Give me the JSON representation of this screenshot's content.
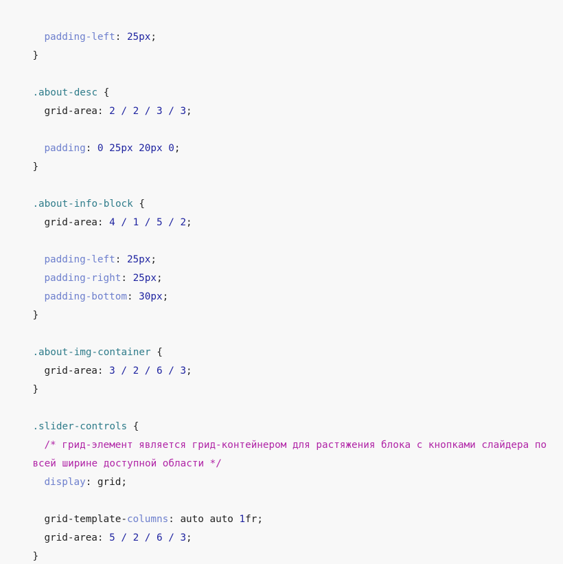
{
  "colors": {
    "background": "#f8f8f8",
    "selector": "#2f7c8a",
    "property_highlight": "#6d7fcd",
    "number": "#1e23a0",
    "comment": "#b024a6",
    "text": "#1f1f1f"
  },
  "code": {
    "l1": {
      "prop": "padding-left",
      "colon": ":",
      "value": "25px",
      "semi": ";"
    },
    "l2": {
      "text": "}"
    },
    "b1": {
      "selector": ".about-desc",
      "open": "{",
      "grid_prop": "grid-area",
      "colon": ":",
      "v1": "2",
      "v2": "2",
      "v3": "3",
      "v4": "3",
      "slash": "/",
      "semi": ";",
      "pad_prop": "padding",
      "pad_value": "0 25px 20px 0",
      "close": "}"
    },
    "b2": {
      "selector": ".about-info-block",
      "open": "{",
      "grid_prop": "grid-area",
      "colon": ":",
      "v1": "4",
      "v2": "1",
      "v3": "5",
      "v4": "2",
      "slash": "/",
      "semi": ";",
      "pl_prop": "padding-left",
      "pl_value": "25px",
      "pr_prop": "padding-right",
      "pr_value": "25px",
      "pb_prop": "padding-bottom",
      "pb_value": "30px",
      "close": "}"
    },
    "b3": {
      "selector": ".about-img-container",
      "open": "{",
      "grid_prop": "grid-area",
      "colon": ":",
      "v1": "3",
      "v2": "2",
      "v3": "6",
      "v4": "3",
      "slash": "/",
      "semi": ";",
      "close": "}"
    },
    "b4": {
      "selector": ".slider-controls",
      "open": "{",
      "comment_line1": "/* грид-элемент является грид-контейнером для растяжения блока с кнопками слайдера по",
      "comment_line2": "всей ширине доступной области */",
      "display_prop": "display",
      "display_value": "grid",
      "colon": ":",
      "semi": ";",
      "gtc_prop_a": "grid-template-",
      "gtc_prop_b": "columns",
      "gtc_value_a": "auto auto ",
      "gtc_value_num": "1",
      "gtc_value_b": "fr",
      "grid_prop": "grid-area",
      "v1": "5",
      "v2": "2",
      "v3": "6",
      "v4": "3",
      "slash": "/",
      "close": "}"
    }
  }
}
